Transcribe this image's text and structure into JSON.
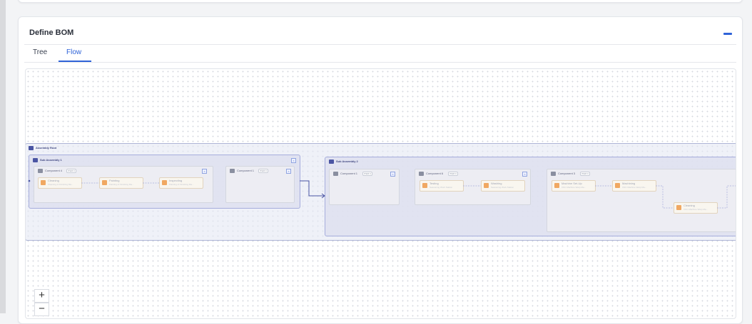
{
  "page": {
    "title": "Define BOM",
    "tabs": [
      {
        "label": "Tree",
        "active": false
      },
      {
        "label": "Flow",
        "active": true
      }
    ]
  },
  "colors": {
    "accent": "#2f63d8",
    "operation_icon": "#f0a862",
    "group_border": "#aeb5d6"
  },
  "flow": {
    "assembly_root": {
      "label": "Assembly Root"
    },
    "sub_assembly_1": {
      "label": "Sub Assembly 1"
    },
    "sub_assembly_2": {
      "label": "Sub Assembly 2"
    },
    "components": {
      "c1": {
        "label": "Component 4",
        "badge": "ITEM 0"
      },
      "c2": {
        "label": "Component 1",
        "badge": "ITEM 0"
      },
      "c3": {
        "label": "Component 1",
        "badge": "ITEM 0"
      },
      "c4": {
        "label": "Component 6",
        "badge": "ITEM 0"
      },
      "c5": {
        "label": "Component 3",
        "badge": "ITEM 0"
      }
    },
    "operations": {
      "o1": {
        "name": "Cleaning",
        "sub": "Cleaning of Finishing Ma..."
      },
      "o2": {
        "name": "Painting",
        "sub": "Painting of Finishing Ma..."
      },
      "o3": {
        "name": "Inspecting",
        "sub": "Painting of Finishing Ma..."
      },
      "o4": {
        "name": "Testing",
        "sub": "Seasoning Work Station"
      },
      "o5": {
        "name": "Washing",
        "sub": "Seasoning Work Station"
      },
      "o6": {
        "name": "Machine Set-Up",
        "sub": "CNC Machine Warp Ma..."
      },
      "o7": {
        "name": "Machining",
        "sub": "CNC Machine Warp Ma..."
      },
      "o8": {
        "name": "Cleaning",
        "sub": "CNC Machine Warp Ma..."
      }
    }
  },
  "zoom_controls": {
    "zoom_in": "+",
    "zoom_out": "−"
  }
}
